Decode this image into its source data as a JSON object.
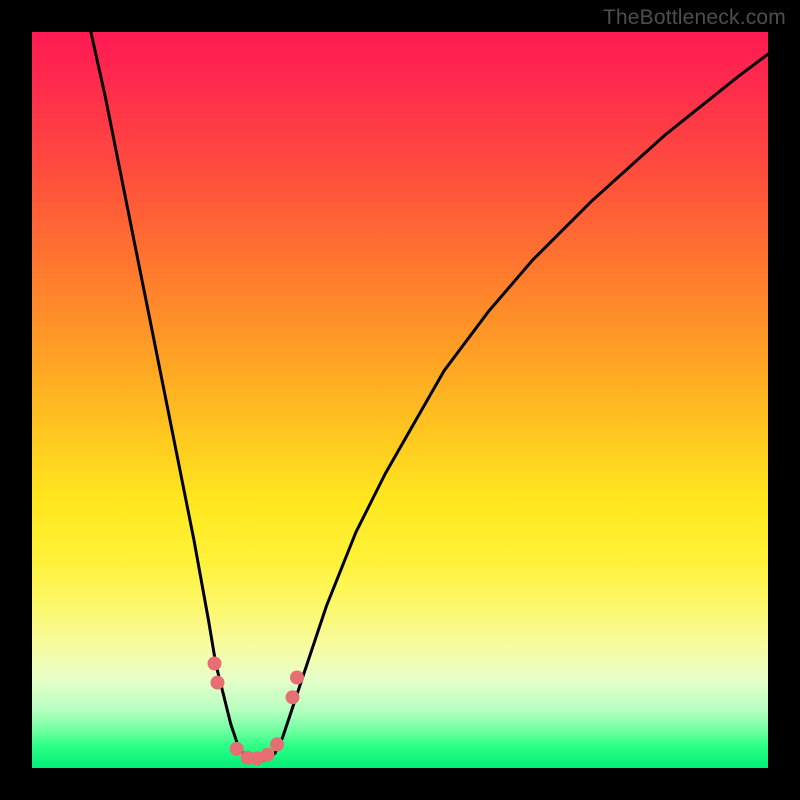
{
  "watermark": {
    "text": "TheBottleneck.com"
  },
  "colors": {
    "page_bg": "#000000",
    "curve": "#000000",
    "marker_fill": "#e76e73",
    "gradient_top": "#ff1a52",
    "gradient_bottom": "#00ef77"
  },
  "chart_data": {
    "type": "line",
    "title": "",
    "xlabel": "",
    "ylabel": "",
    "xlim": [
      0,
      100
    ],
    "ylim": [
      0,
      100
    ],
    "grid": false,
    "legend": false,
    "notes": "V-shaped bottleneck curve over red→yellow→green vertical gradient. y≈0 is optimal (green), y≈100 is worst (red). Minimum around x≈30. Axis values estimated from pixel positions; original has no tick labels.",
    "series": [
      {
        "name": "bottleneck-curve",
        "x": [
          8,
          10,
          12,
          14,
          16,
          18,
          20,
          22,
          24,
          25,
          26,
          27,
          28,
          29,
          30,
          31,
          32,
          33,
          34,
          35,
          37,
          40,
          44,
          48,
          52,
          56,
          62,
          68,
          76,
          86,
          96,
          100
        ],
        "y": [
          100,
          91,
          81,
          71,
          61,
          51,
          41,
          31,
          20,
          14,
          10,
          6,
          3,
          1.5,
          1,
          1,
          1.2,
          2,
          4,
          7,
          13,
          22,
          32,
          40,
          47,
          54,
          62,
          69,
          77,
          86,
          94,
          97
        ]
      }
    ],
    "markers": [
      {
        "x": 24.8,
        "y": 14.2
      },
      {
        "x": 25.2,
        "y": 11.6
      },
      {
        "x": 27.8,
        "y": 2.6
      },
      {
        "x": 29.3,
        "y": 1.4
      },
      {
        "x": 30.6,
        "y": 1.3
      },
      {
        "x": 32.0,
        "y": 1.8
      },
      {
        "x": 33.3,
        "y": 3.2
      },
      {
        "x": 35.4,
        "y": 9.6
      },
      {
        "x": 36.0,
        "y": 12.3
      }
    ],
    "marker_radius_px": 7
  }
}
